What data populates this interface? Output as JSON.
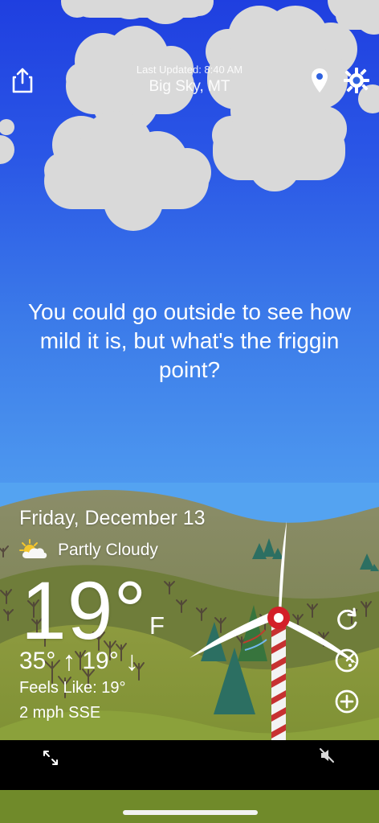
{
  "header": {
    "last_updated": "Last Updated: 8:40 AM",
    "location": "Big Sky, MT"
  },
  "message": {
    "text": "You could go outside to see how mild it is, but what's the friggin point?"
  },
  "weather": {
    "date": "Friday, December 13",
    "condition_text": "Partly Cloudy",
    "temperature": "19°",
    "unit": "F",
    "high": "35°",
    "high_arrow": "↑",
    "low": "19°",
    "low_arrow": "↓",
    "feels_like": "Feels Like: 19°",
    "wind": "2 mph SSE"
  },
  "icons": {
    "share": "share-icon",
    "location": "location-pin-icon",
    "settings": "gear-icon",
    "condition": "partly-cloudy-icon",
    "refresh": "refresh-icon",
    "radar": "radar-icon",
    "add": "plus-circle-icon",
    "expand": "expand-icon",
    "mute": "mute-icon"
  }
}
